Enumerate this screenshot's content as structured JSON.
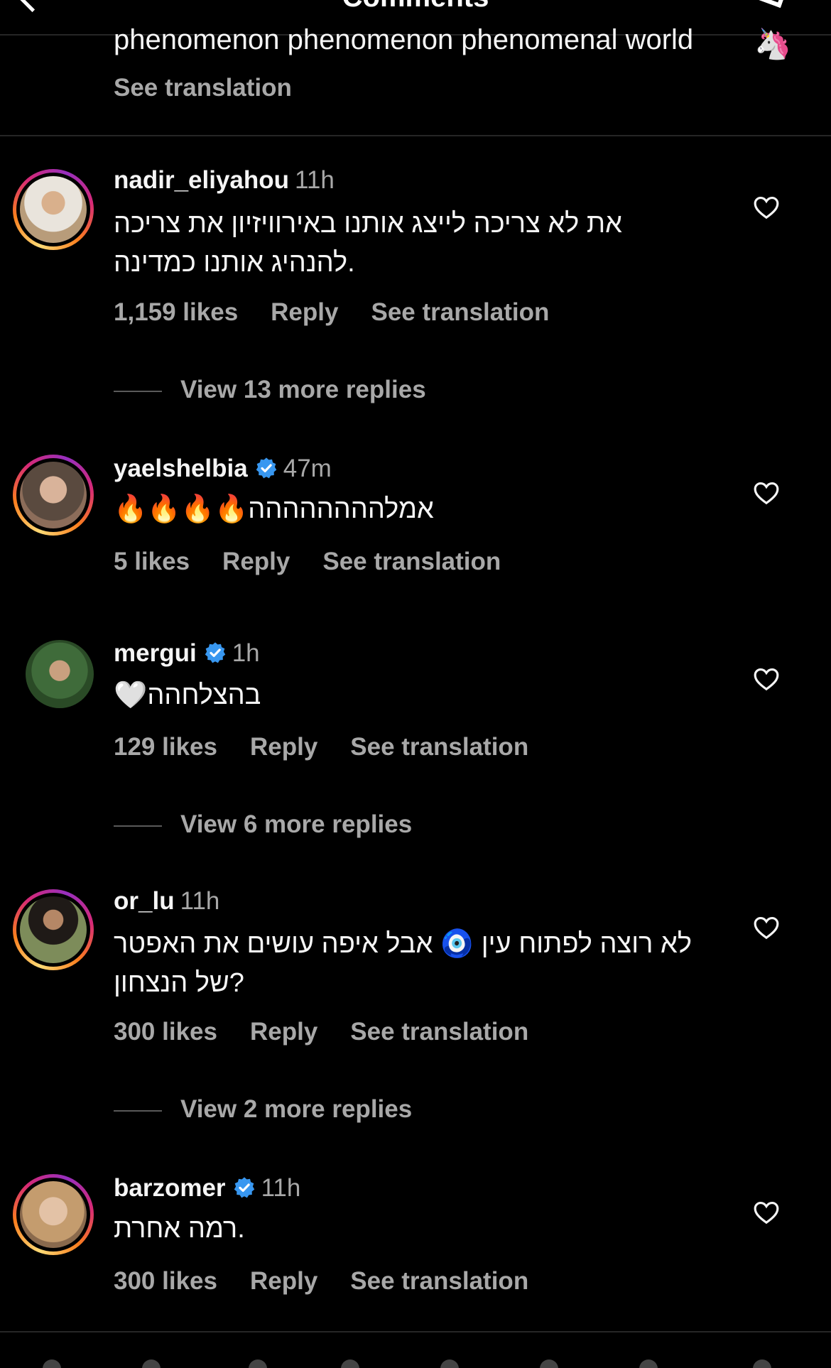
{
  "header": {
    "title": "Comments"
  },
  "previous_comment": {
    "text": "phenomenon phenomenon phenomenal world",
    "emoji": "🦄",
    "see_translation": "See translation"
  },
  "comments": [
    {
      "username": "nadir_eliyahou",
      "verified": false,
      "time": "11h",
      "lines": [
        "את לא צריכה לייצג אותנו באירוויזיון את צריכה",
        "להנהיג אותנו כמדינה."
      ],
      "likes": "1,159 likes",
      "reply": "Reply",
      "see_translation": "See translation",
      "view_more": "View 13 more replies",
      "avatar_icon": "avatar-photo"
    },
    {
      "username": "yaelshelbia",
      "verified": true,
      "time": "47m",
      "lines": [
        "🔥🔥🔥🔥אמלהההההההה"
      ],
      "likes": "5 likes",
      "reply": "Reply",
      "see_translation": "See translation",
      "avatar_icon": "avatar-photo"
    },
    {
      "username": "mergui",
      "verified": true,
      "time": "1h",
      "lines": [
        "🤍בהצלחהה"
      ],
      "likes": "129 likes",
      "reply": "Reply",
      "see_translation": "See translation",
      "view_more": "View 6 more replies",
      "avatar_icon": "avatar-photo"
    },
    {
      "username": "or_lu",
      "verified": false,
      "time": "11h",
      "lines": [
        "לא רוצה לפתוח עין 🧿 אבל איפה עושים את האפטר",
        "של הנצחון?"
      ],
      "likes": "300 likes",
      "reply": "Reply",
      "see_translation": "See translation",
      "view_more": "View 2 more replies",
      "avatar_icon": "avatar-photo"
    },
    {
      "username": "barzomer",
      "verified": true,
      "time": "11h",
      "lines": [
        "רמה אחרת."
      ],
      "likes": "300 likes",
      "reply": "Reply",
      "see_translation": "See translation",
      "avatar_icon": "avatar-photo"
    }
  ],
  "colors": {
    "background": "#000000",
    "text": "#f5f5f5",
    "secondary": "#a8a8a8",
    "verified": "#3897f0",
    "divider": "#262626"
  }
}
